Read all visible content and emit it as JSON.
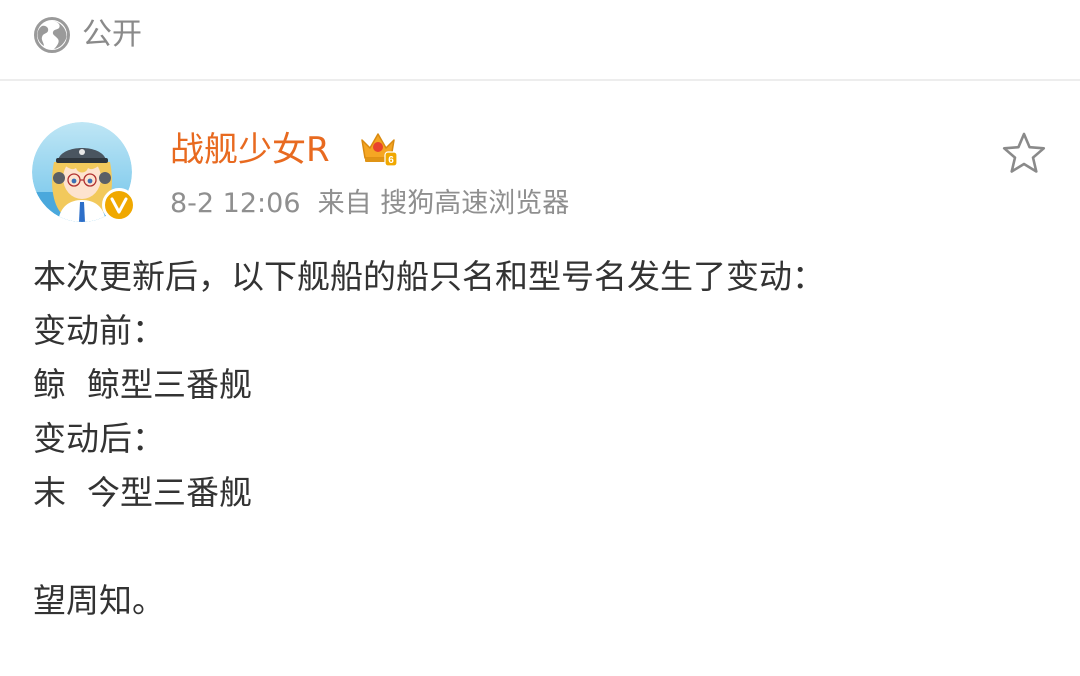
{
  "header": {
    "visibility_label": "公开",
    "visibility_icon": "globe-icon"
  },
  "post": {
    "author": {
      "name": "战舰少女R",
      "avatar": "anime-avatar",
      "verified_badge": "verified-v-badge",
      "member_badge": "crown-vip-badge",
      "member_level": "6"
    },
    "meta": {
      "time": "8-2 12:06",
      "source_prefix": "来自",
      "source": "搜狗高速浏览器"
    },
    "favorite_icon": "star-outline-icon",
    "body": {
      "line1": "本次更新后，以下舰船的船只名和型号名发生了变动：",
      "line2": "变动前：",
      "line3": "鲸  鲸型三番舰",
      "line4": "变动后：",
      "line5": "末  今型三番舰",
      "line6": "望周知。"
    }
  },
  "colors": {
    "accent": "#e86a20",
    "meta_gray": "#8f8f8f",
    "badge_gold": "#f0a800",
    "divider": "#ededed"
  }
}
